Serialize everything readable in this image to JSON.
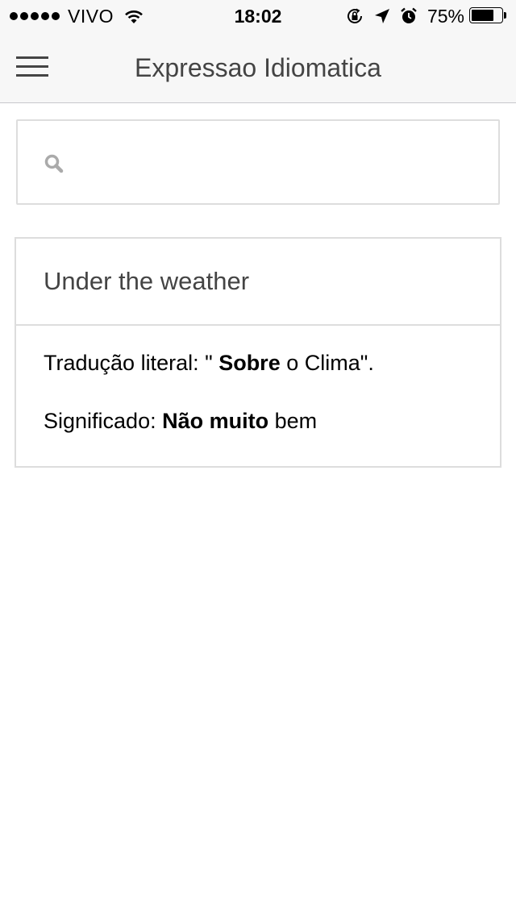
{
  "status_bar": {
    "carrier": "VIVO",
    "time": "18:02",
    "battery_percent": "75%",
    "battery_level": 0.75
  },
  "nav": {
    "title": "Expressao Idiomatica"
  },
  "search": {
    "placeholder": "",
    "value": ""
  },
  "card": {
    "title": "Under the weather",
    "translation": {
      "label": "Tradução literal: \"",
      "bold": "Sobre",
      "rest": "o Clima\"."
    },
    "meaning": {
      "label": "Significado:",
      "bold": "Não muito",
      "rest": "bem"
    }
  },
  "colors": {
    "header_bg": "#f7f7f7",
    "text_gray": "#444444",
    "border": "#dddddd"
  }
}
